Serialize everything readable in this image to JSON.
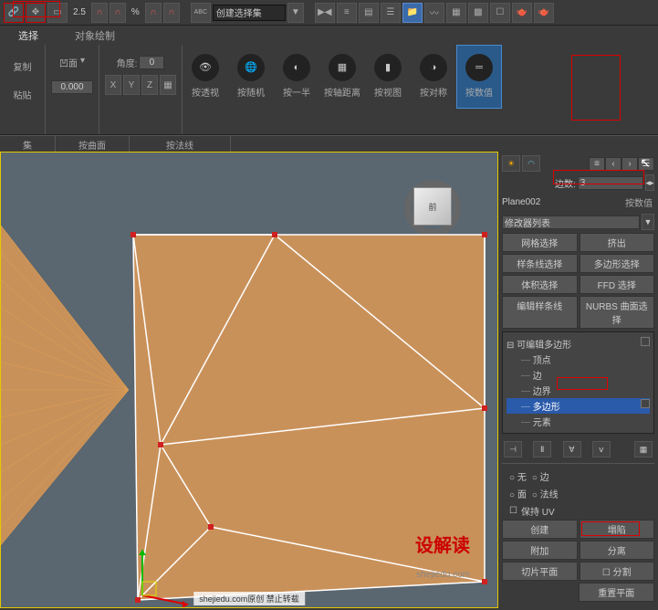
{
  "top_toolbar": {
    "snap_val": "2.5",
    "percent": "%",
    "dropdown": "创建选择集"
  },
  "ribbon": {
    "tabs": {
      "select": "选择",
      "obj_draw": "对象绘制"
    },
    "copy": "复制",
    "paste": "粘贴",
    "concave": "凹面",
    "concave_val": "0.000",
    "angle": "角度:",
    "angle_val": "0",
    "xyz": [
      "X",
      "Y",
      "Z"
    ],
    "big_buttons": [
      "按透视",
      "按随机",
      "按一半",
      "按轴距离",
      "按视图",
      "按对称",
      "按数值"
    ],
    "bottom": [
      "集",
      "按曲面",
      "按法线"
    ]
  },
  "viewcube": "前",
  "panel": {
    "edges_label": "边数:",
    "edges_val": "3",
    "by_numeric": "按数值",
    "object": "Plane002",
    "modlist": "修改器列表",
    "buttons": [
      "网格选择",
      "挤出",
      "样条线选择",
      "多边形选择",
      "体积选择",
      "FFD 选择",
      "编辑样条线",
      "NURBS 曲面选择"
    ],
    "tree": {
      "root": "可编辑多边形",
      "items": [
        "顶点",
        "边",
        "边界",
        "多边形",
        "元素"
      ],
      "selected": 3
    },
    "radios": {
      "none": "无",
      "edge": "边",
      "face": "面",
      "normal": "法线"
    },
    "keep_uv": "保持 UV",
    "row1": [
      "创建",
      "塌陷"
    ],
    "row2": [
      "附加",
      "分离"
    ],
    "row3": [
      "切片平面",
      "分割"
    ],
    "reset": "重置平面"
  },
  "watermark": {
    "big": "设解读",
    "url": "shejiedu.com",
    "caption": "shejiedu.com原创 禁止转载"
  }
}
